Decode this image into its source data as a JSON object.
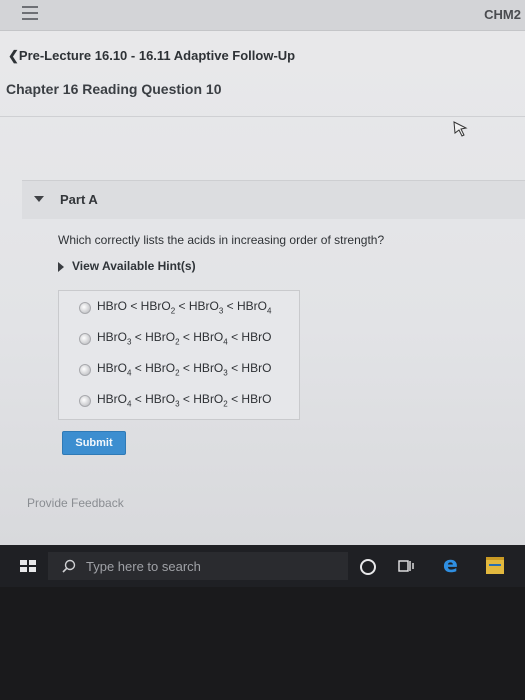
{
  "topbar": {
    "course": "CHM2"
  },
  "breadcrumb": {
    "label": "❮Pre-Lecture 16.10 - 16.11 Adaptive Follow-Up"
  },
  "chapter": {
    "title": "Chapter 16 Reading Question 10"
  },
  "part": {
    "label": "Part A"
  },
  "question": {
    "text": "Which correctly lists the acids in increasing order of strength?"
  },
  "hint": {
    "label": "View Available Hint(s)"
  },
  "options": [
    {
      "segments": [
        "HBrO",
        "",
        " < HBrO",
        "2",
        " < HBrO",
        "3",
        " < HBrO",
        "4"
      ]
    },
    {
      "segments": [
        "HBrO",
        "3",
        " < HBrO",
        "2",
        " < HBrO",
        "4",
        " < HBrO",
        ""
      ]
    },
    {
      "segments": [
        "HBrO",
        "4",
        " < HBrO",
        "2",
        " < HBrO",
        "3",
        " < HBrO",
        ""
      ]
    },
    {
      "segments": [
        "HBrO",
        "4",
        " < HBrO",
        "3",
        " < HBrO",
        "2",
        " < HBrO",
        ""
      ]
    }
  ],
  "submit": {
    "label": "Submit"
  },
  "feedback": {
    "label": "Provide Feedback"
  },
  "taskbar": {
    "search_placeholder": "Type here to search"
  },
  "colors": {
    "accent": "#3c8ed0",
    "edge": "#2f8fe2"
  }
}
